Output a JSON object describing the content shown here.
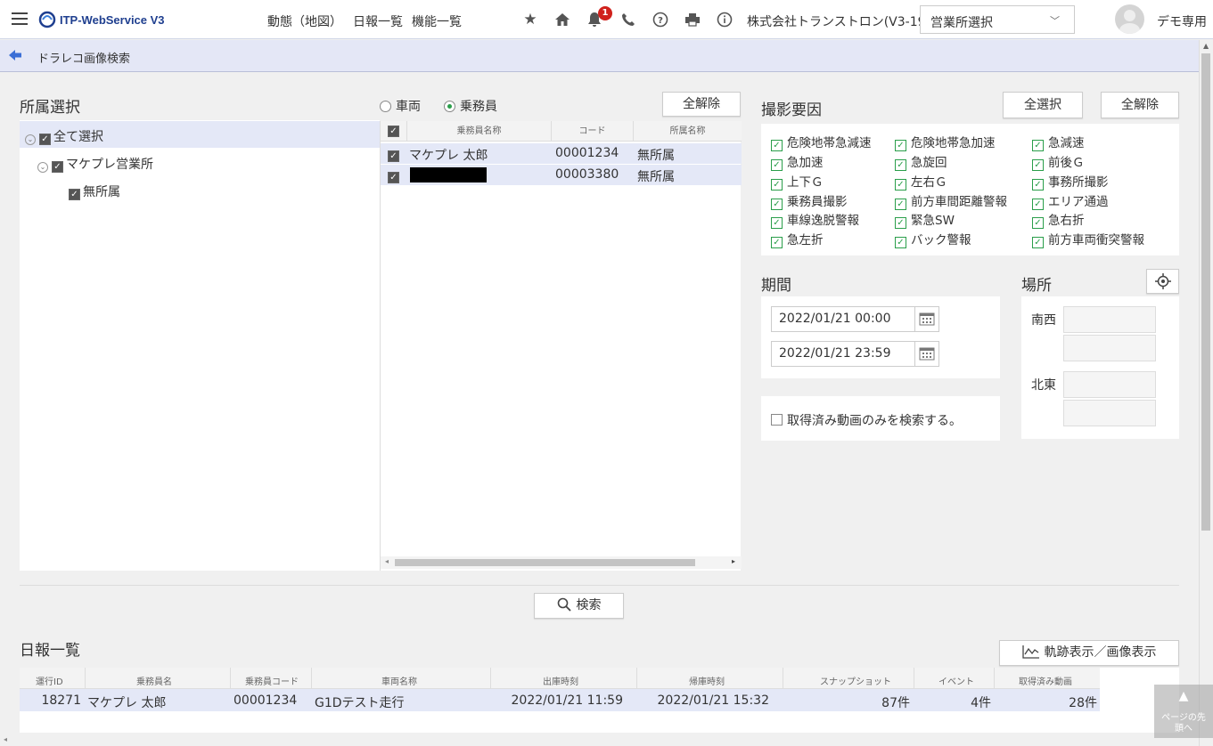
{
  "header": {
    "app_name": "ITP-WebService V3",
    "nav": [
      "動態（地図）",
      "日報一覧",
      "機能一覧"
    ],
    "notification_count": "1",
    "company": "株式会社トランストロン(V3-19)",
    "office_select": "営業所選択",
    "user": "デモ専用"
  },
  "breadcrumb": {
    "title": "ドラレコ画像検索"
  },
  "affiliation": {
    "title": "所属選択",
    "tree": [
      {
        "label": "全て選択",
        "level": 0
      },
      {
        "label": "マケプレ営業所",
        "level": 1
      },
      {
        "label": "無所属",
        "level": 2
      }
    ]
  },
  "target": {
    "radio_vehicle": "車両",
    "radio_crew": "乗務員",
    "selected": "乗務員",
    "clear_all": "全解除",
    "columns": [
      "乗務員名称",
      "コード",
      "所属名称"
    ],
    "rows": [
      {
        "name": "マケプレ 太郎",
        "code": "00001234",
        "affiliation": "無所属",
        "redacted": false
      },
      {
        "name": "",
        "code": "00003380",
        "affiliation": "無所属",
        "redacted": true
      }
    ]
  },
  "factors": {
    "title": "撮影要因",
    "select_all": "全選択",
    "clear_all": "全解除",
    "items": [
      "危険地帯急減速",
      "危険地帯急加速",
      "急減速",
      "急加速",
      "急旋回",
      "前後Ｇ",
      "上下Ｇ",
      "左右Ｇ",
      "事務所撮影",
      "乗務員撮影",
      "前方車間距離警報",
      "エリア通過",
      "車線逸脱警報",
      "緊急SW",
      "急右折",
      "急左折",
      "バック警報",
      "前方車両衝突警報"
    ]
  },
  "period": {
    "title": "期間",
    "from": "2022/01/21 00:00",
    "to": "2022/01/21 23:59",
    "only_acquired": "取得済み動画のみを検索する。"
  },
  "location": {
    "title": "場所",
    "southwest": "南西",
    "northeast": "北東"
  },
  "search_button": "検索",
  "daily_report": {
    "title": "日報一覧",
    "track_button": "軌跡表示／画像表示",
    "columns": [
      "運行ID",
      "乗務員名",
      "乗務員コード",
      "車両名称",
      "出庫時刻",
      "帰庫時刻",
      "スナップショット",
      "イベント",
      "取得済み動画"
    ],
    "rows": [
      {
        "id": "18271",
        "driver": "マケプレ 太郎",
        "code": "00001234",
        "vehicle": "G1Dテスト走行",
        "out": "2022/01/21 11:59",
        "in": "2022/01/21 15:32",
        "snapshot": "87件",
        "event": "4件",
        "video": "28件"
      }
    ]
  },
  "page_top": "ページの先頭へ"
}
